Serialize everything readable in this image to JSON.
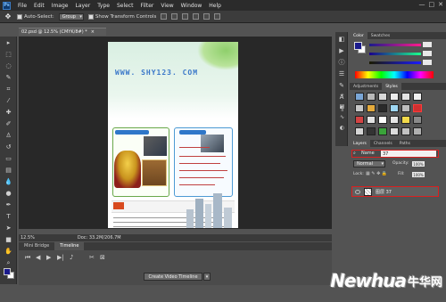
{
  "app": {
    "menu": [
      "File",
      "Edit",
      "Image",
      "Layer",
      "Type",
      "Select",
      "Filter",
      "View",
      "Window",
      "Help"
    ],
    "logo_text": "Ps",
    "window_controls": [
      "—",
      "□",
      "✕"
    ]
  },
  "options": {
    "auto_select_label": "Auto-Select:",
    "auto_select_value": "Group",
    "transform_label": "Show Transform Controls"
  },
  "document": {
    "tab_title": "02.psd @ 12.5% (CMYK/8#) *",
    "close_glyph": "×",
    "url_text": "WWW. SHY123. COM",
    "zoom_status": "12.5%",
    "doc_status": "Doc: 33.2M/206.7M"
  },
  "timeline": {
    "tabs": [
      "Mini Bridge",
      "Timeline"
    ],
    "create_button": "Create Video Timeline"
  },
  "panels": {
    "top_tabs": [
      "Color",
      "Swatches"
    ],
    "color_values": [
      "",
      "",
      ""
    ],
    "middle_tabs": [
      "Adjustments",
      "Styles"
    ],
    "layers_tabs": [
      "Layers",
      "Channels",
      "Paths"
    ],
    "filter_label": "Name",
    "filter_value": "37",
    "blend_mode": "Normal",
    "opacity_label": "Opacity:",
    "opacity_value": "100%",
    "lock_label": "Lock:",
    "fill_label": "Fill:",
    "fill_value": "100%",
    "layer_name": "图层 37"
  },
  "watermark": {
    "text": "Newhua",
    "cn_text": "牛华网"
  },
  "colors": {
    "accent_red": "#d92020",
    "fg_swatch": "#1b1b8c",
    "bg_swatch": "#ffffff"
  }
}
